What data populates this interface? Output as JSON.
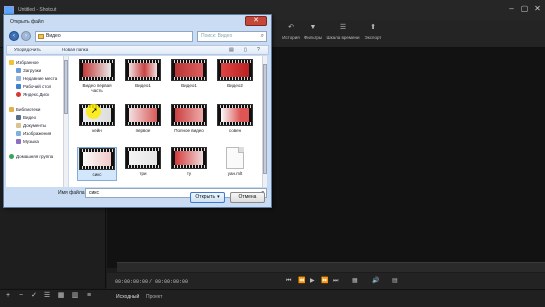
{
  "window": {
    "title": "Untitled - Shotcut"
  },
  "toolbar": {
    "items": [
      {
        "label": "История",
        "icon": "history-icon"
      },
      {
        "label": "Фильтры",
        "icon": "filters-icon"
      },
      {
        "label": "Шкала времени",
        "icon": "timeline-icon"
      },
      {
        "label": "Экспорт",
        "icon": "export-icon"
      }
    ]
  },
  "dialog": {
    "title": "Открыть файл",
    "path": "Видео",
    "search_placeholder": "Поиск: Видео",
    "commands": {
      "organize": "Упорядочить",
      "new_folder": "Новая папка"
    },
    "nav": {
      "favorites": "Избранное",
      "downloads": "Загрузки",
      "recent": "Недавние места",
      "desktop": "Рабочий стол",
      "yandex_disk": "Яндекс.Диск",
      "libraries": "Библиотеки",
      "video": "Видео",
      "documents": "Документы",
      "images": "Изображения",
      "music": "Музыка",
      "homegroup": "Домашняя группа"
    },
    "files": [
      {
        "name": "Видео первая часть",
        "kind": "video"
      },
      {
        "name": "Видео1",
        "kind": "video"
      },
      {
        "name": "Видео1",
        "kind": "video"
      },
      {
        "name": "Видео2",
        "kind": "video"
      },
      {
        "name": "кейн",
        "kind": "video"
      },
      {
        "name": "первое",
        "kind": "video"
      },
      {
        "name": "Полное видео",
        "kind": "video"
      },
      {
        "name": "совен",
        "kind": "video"
      },
      {
        "name": "сикс",
        "kind": "video"
      },
      {
        "name": "три",
        "kind": "video"
      },
      {
        "name": "ту",
        "kind": "video"
      },
      {
        "name": "уан.mlt",
        "kind": "document"
      }
    ],
    "filename_label": "Имя файла:",
    "filename_value": "сикс",
    "open_label": "Открыть",
    "cancel_label": "Отмена"
  },
  "transport": {
    "current": "00:00:00:00",
    "separator": "/",
    "duration": "00:00:00:00"
  },
  "bottom": {
    "tabs": [
      "Исходный",
      "Проект"
    ]
  }
}
